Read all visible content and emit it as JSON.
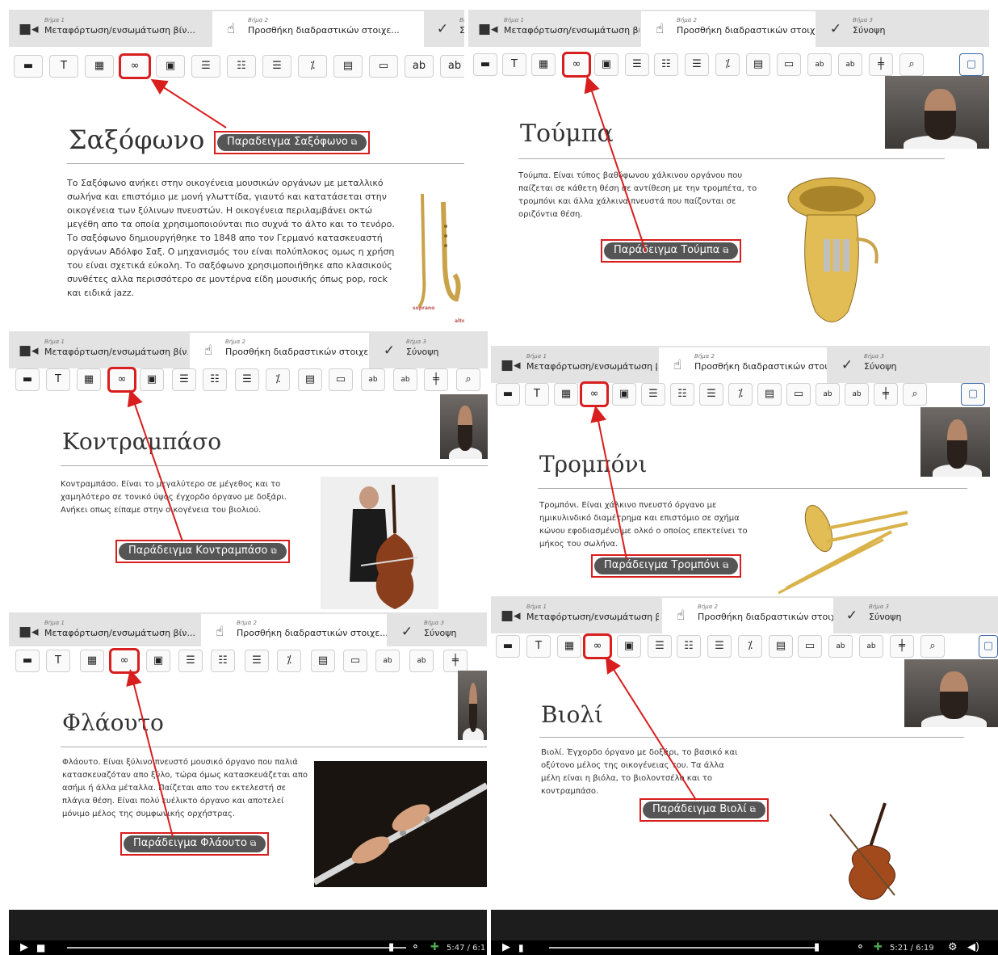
{
  "tabs": {
    "step1": {
      "step": "Βήμα 1",
      "label": "Μεταφόρτωση/ενσωμάτωση βίν..."
    },
    "step2": {
      "step": "Βήμα 2",
      "label": "Προσθήκη διαδραστικών στοιχε..."
    },
    "step3": {
      "step": "Βήμα 3",
      "label": "Σύνοψη"
    },
    "step3_cut": "Σύ",
    "step3_step_cut": "Βή"
  },
  "toolbar": {
    "text_label": "T",
    "percent_label": "⁒",
    "icons": [
      "label-icon",
      "text-icon",
      "table-icon",
      "link-icon",
      "image-icon",
      "statements-icon",
      "single-choice-icon",
      "multi-choice-icon",
      "percent-icon",
      "drag-text-icon",
      "dialog-icon",
      "mark-words-icon",
      "fill-blanks-icon",
      "crossroads-icon",
      "navigation-hotspot-icon",
      "summary-icon"
    ]
  },
  "panels": [
    {
      "id": "saxophone",
      "title": "Σαξόφωνο",
      "example": "Παραδειγμα Σαξόφωνο",
      "text": "Το Σαξόφωνο ανήκει στην οικογένεια μουσικών οργάνων με μεταλλικό σωλήνα και επιστόμιο με μονή γλωττίδα, γιαυτό και κατατάσεται στην οικογένεια των ξύλινων πνευστών. Η οικογένεια περιλαμβάνει οκτώ μεγέθη απο τα οποία χρησιμοποιούνται πιο συχνά το άλτο και το τενόρο. Το σαξόφωνο δημιουργήθηκε το 1848 απο τον Γερμανό κατασκευαστή οργάνων Αδόλφο Σαξ. Ο μηχανισμός του είναι πολύπλοκος ομως η χρήση του είναι σχετικά εύκολη. Το σαξόφωνο χρησιμοποιήθηκε απο κλασικούς συνθέτες αλλα περισσότερο σε μοντέρνα είδη μουσικής όπως pop, rock και ειδικά jazz.",
      "caption1": "soprano",
      "caption2": "alto"
    },
    {
      "id": "tuba",
      "title": "Τούμπα",
      "example": "Παράδειγμα Τούμπα",
      "text": "Τούμπα. Είναι τύπος βαθύφωνου χάλκινου οργάνου που παίζεται σε κάθετη θέση σε αντίθεση με την τρομπέτα, το τρομπόνι και άλλα χάλκινα πνευστά που παίζονται σε οριζόντια θέση."
    },
    {
      "id": "contrabass",
      "title": "Κοντραμπάσο",
      "example": "Παράδειγμα Κοντραμπάσο",
      "text": "Κοντραμπάσο. Είναι το μεγαλύτερο σε μέγεθος και το χαμηλότερο σε τονικό ύψος έγχορδο όργανο με δοξάρι. Ανήκει οπως είπαμε στην οικογένεια του βιολιού."
    },
    {
      "id": "trombone",
      "title": "Τρομπόνι",
      "example": "Παράδειγμα Τρομπόνι",
      "text": "Τρομπόνι. Είναι χάλκινο πνευστό όργανο με ημικυλινδικό διαμέτρημα και επιστόμιο σε σχήμα κώνου εφοδιασμένο με ολκό ο οποίος επεκτείνει το μήκος του σωλήνα."
    },
    {
      "id": "flute",
      "title": "Φλάουτο",
      "example": "Παράδειγμα Φλάουτο",
      "text": "Φλάουτο. Είναι ξύλινο πνευστό μουσικό όργανο που παλιά κατασκευαζόταν απο ξύλο, τώρα όμως κατασκευάζεται απο ασήμι ή άλλα μέταλλα. Παίζεται απο τον εκτελεστή σε πλάγια θέση. Είναι πολύ ευέλικτο όργανο και αποτελεί μόνιμο μέλος της συμφωνικής ορχήστρας.",
      "time": "5:47 / 6:1"
    },
    {
      "id": "violin",
      "title": "Βιολί",
      "example": "Παράδειγμα Βιολί",
      "text": "Βιολί. Έγχορδο όργανο με δοξάρι, το βασικό και οξύτονο μέλος της οικογένειας του. Τα άλλα μέλη είναι η βιόλα, το βιολοντσέλο και το κοντραμπάσο.",
      "time": "5:21 / 6:19"
    }
  ],
  "colors": {
    "highlight": "#d81e1e",
    "pill": "#555555",
    "tabbar": "#e3e3e3"
  }
}
